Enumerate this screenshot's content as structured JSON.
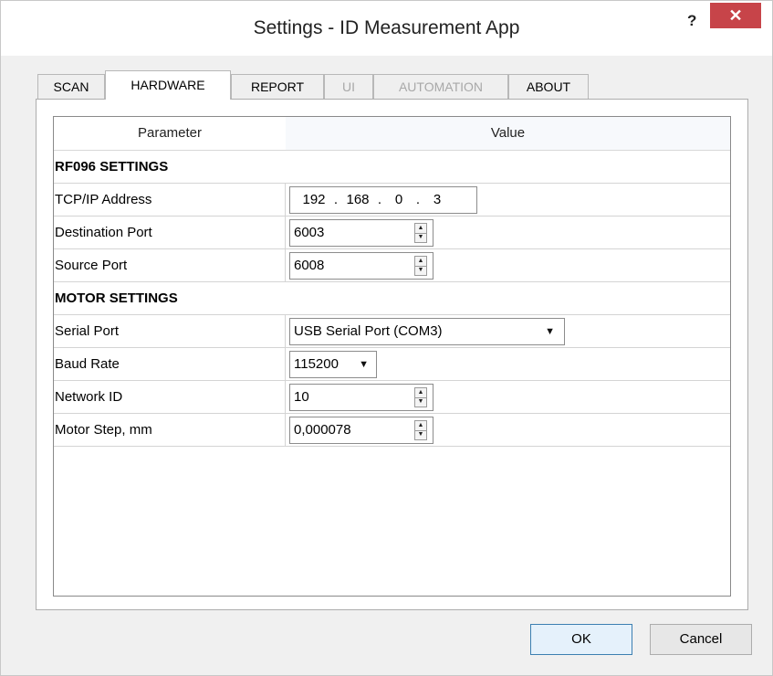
{
  "window": {
    "title": "Settings - ID Measurement App",
    "help": "?",
    "close": "✕"
  },
  "tabs": [
    {
      "label": "SCAN",
      "state": "normal"
    },
    {
      "label": "HARDWARE",
      "state": "active"
    },
    {
      "label": "REPORT",
      "state": "normal"
    },
    {
      "label": "UI",
      "state": "disabled"
    },
    {
      "label": "AUTOMATION",
      "state": "disabled"
    },
    {
      "label": "ABOUT",
      "state": "normal"
    }
  ],
  "grid": {
    "columns": [
      "Parameter",
      "Value"
    ],
    "rf_section": "RF096 SETTINGS",
    "tcp_label": "TCP/IP Address",
    "tcp_octets": [
      "192",
      "168",
      "0",
      "3"
    ],
    "dest_label": "Destination Port",
    "dest_value": "6003",
    "src_label": "Source Port",
    "src_value": "6008",
    "motor_section": "MOTOR SETTINGS",
    "serial_label": "Serial Port",
    "serial_value": "USB Serial Port (COM3)",
    "baud_label": "Baud Rate",
    "baud_value": "115200",
    "netid_label": "Network ID",
    "netid_value": "10",
    "step_label": "Motor Step, mm",
    "step_value": "0,000078"
  },
  "buttons": {
    "ok": "OK",
    "cancel": "Cancel"
  },
  "colors": {
    "close_bg": "#c74449",
    "ok_border": "#3c7fb1"
  }
}
